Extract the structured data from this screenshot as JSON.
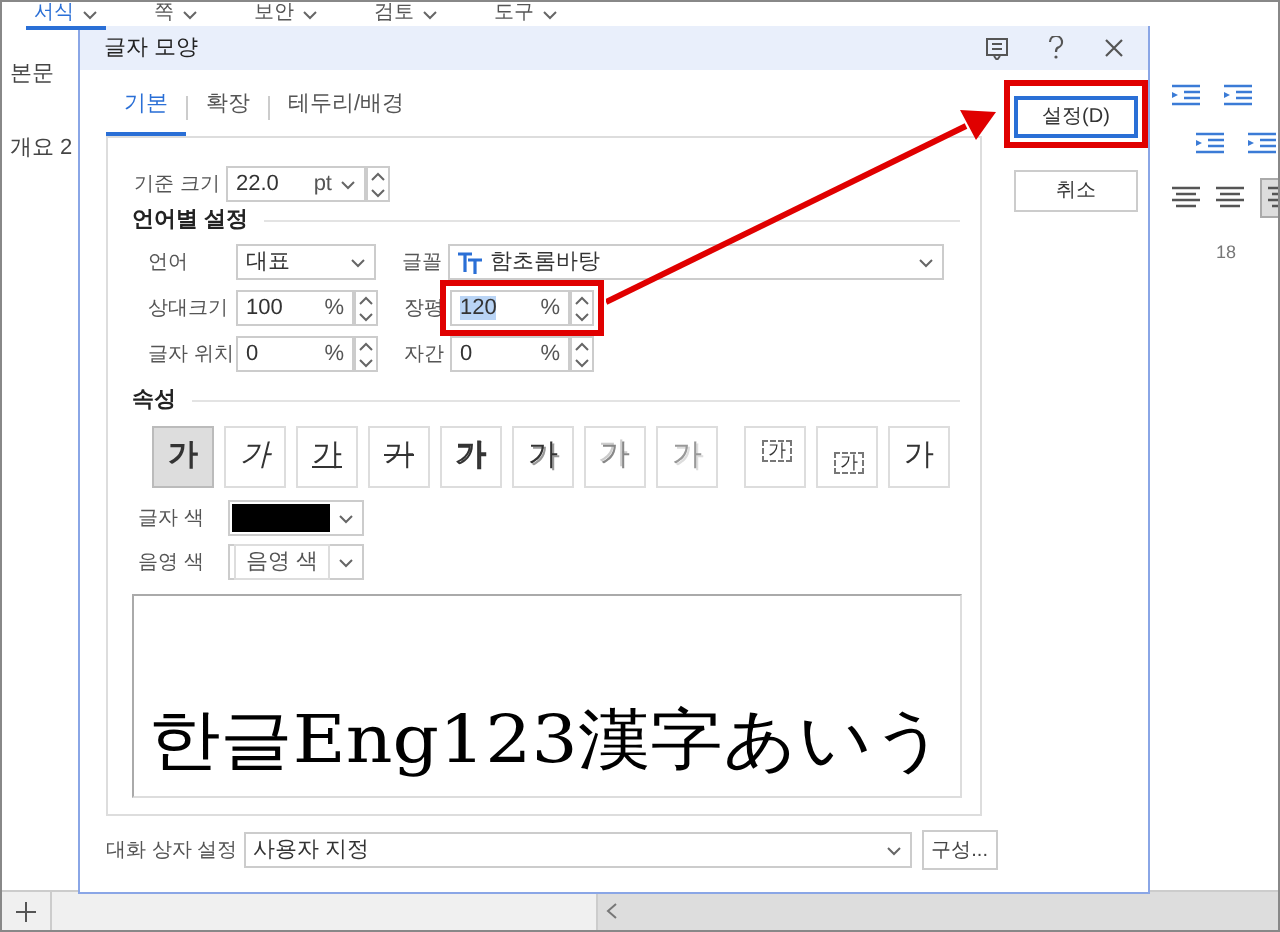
{
  "app": {
    "menu_tabs": [
      {
        "label": "서식",
        "selected": true
      },
      {
        "label": "쪽",
        "selected": false
      },
      {
        "label": "보안",
        "selected": false
      },
      {
        "label": "검토",
        "selected": false
      },
      {
        "label": "도구",
        "selected": false
      }
    ],
    "style_items": [
      "본문",
      "개요 2"
    ],
    "ruler_mark": "18"
  },
  "dialog": {
    "title": "글자 모양",
    "tabs": [
      {
        "label": "기본",
        "selected": true
      },
      {
        "label": "확장",
        "selected": false
      },
      {
        "label": "테두리/배경",
        "selected": false
      }
    ],
    "base_size": {
      "label": "기준 크기",
      "value": "22.0",
      "unit": "pt"
    },
    "language_section": "언어별 설정",
    "language": {
      "label": "언어",
      "value": "대표"
    },
    "font": {
      "label": "글꼴",
      "value": "함초롬바탕"
    },
    "relative_size": {
      "label": "상대크기",
      "value": "100",
      "unit": "%",
      "text_selected": false
    },
    "width_ratio": {
      "label": "장평",
      "value": "120",
      "unit": "%",
      "text_selected": true,
      "highlighted": true
    },
    "position": {
      "label": "글자 위치",
      "value": "0",
      "unit": "%",
      "text_selected": false
    },
    "spacing": {
      "label": "자간",
      "value": "0",
      "unit": "%",
      "text_selected": false
    },
    "attributes_section": "속성",
    "attributes": [
      {
        "kind": "bold",
        "label": "가",
        "selected": true
      },
      {
        "kind": "italic",
        "label": "가",
        "selected": false
      },
      {
        "kind": "underline",
        "label": "가",
        "selected": false
      },
      {
        "kind": "strikethrough",
        "label": "가",
        "selected": false
      },
      {
        "kind": "outline",
        "label": "가",
        "selected": false
      },
      {
        "kind": "shadow",
        "label": "가",
        "selected": false
      },
      {
        "kind": "emboss",
        "label": "가",
        "selected": false
      },
      {
        "kind": "engrave",
        "label": "가",
        "selected": false
      },
      {
        "kind": "superscript",
        "label": "가",
        "selected": false
      },
      {
        "kind": "subscript",
        "label": "가",
        "selected": false
      },
      {
        "kind": "normal",
        "label": "가",
        "selected": false
      }
    ],
    "text_color": {
      "label": "글자 색",
      "color": "#000000"
    },
    "shade_color": {
      "label": "음영 색",
      "value": "음영 색"
    },
    "preview_text": "한글Eng123漢字あいう",
    "dialog_settings": {
      "label": "대화 상자 설정",
      "value": "사용자 지정"
    },
    "configure_button": "구성...",
    "buttons": [
      {
        "label": "설정(D)",
        "default": true,
        "highlighted": true
      },
      {
        "label": "취소",
        "default": false
      }
    ]
  }
}
